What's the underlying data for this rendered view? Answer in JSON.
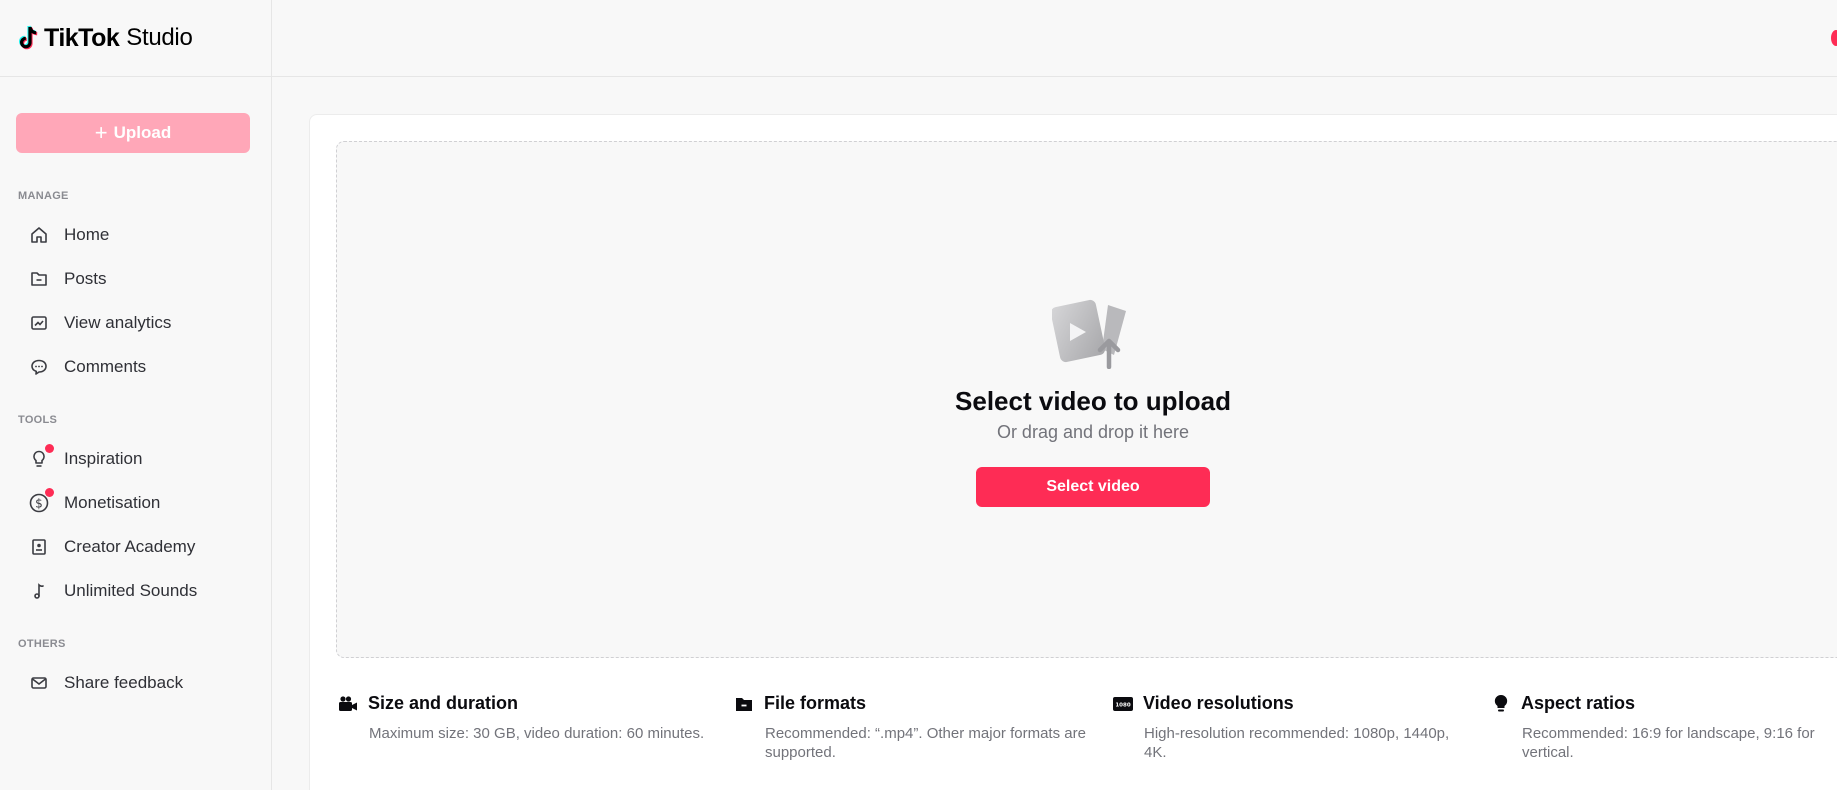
{
  "brand": {
    "name": "TikTok",
    "product": "Studio",
    "accent": "#fe2c55"
  },
  "sidebar": {
    "upload_label": "Upload",
    "sections": {
      "manage": "MANAGE",
      "tools": "TOOLS",
      "others": "OTHERS"
    },
    "manage_items": [
      {
        "label": "Home",
        "icon": "home-icon"
      },
      {
        "label": "Posts",
        "icon": "folder-icon"
      },
      {
        "label": "View analytics",
        "icon": "analytics-icon"
      },
      {
        "label": "Comments",
        "icon": "comment-icon"
      }
    ],
    "tools_items": [
      {
        "label": "Inspiration",
        "icon": "lightbulb-icon",
        "notification": true
      },
      {
        "label": "Monetisation",
        "icon": "dollar-icon",
        "notification": true
      },
      {
        "label": "Creator Academy",
        "icon": "book-icon"
      },
      {
        "label": "Unlimited Sounds",
        "icon": "music-note-icon"
      }
    ],
    "others_items": [
      {
        "label": "Share feedback",
        "icon": "mail-icon"
      }
    ]
  },
  "upload": {
    "title": "Select video to upload",
    "subtitle": "Or drag and drop it here",
    "button": "Select video",
    "icon": "video-upload-icon"
  },
  "info": [
    {
      "title": "Size and duration",
      "desc": "Maximum size: 30 GB, video duration: 60 minutes.",
      "icon": "video-camera-icon"
    },
    {
      "title": "File formats",
      "desc": "Recommended: “.mp4”. Other major formats are supported.",
      "icon": "file-icon"
    },
    {
      "title": "Video resolutions",
      "desc": "High-resolution recommended: 1080p, 1440p, 4K.",
      "icon": "resolution-icon",
      "icon_text": "1080"
    },
    {
      "title": "Aspect ratios",
      "desc": "Recommended: 16:9 for landscape, 9:16 for vertical.",
      "icon": "lightbulb-icon"
    }
  ]
}
